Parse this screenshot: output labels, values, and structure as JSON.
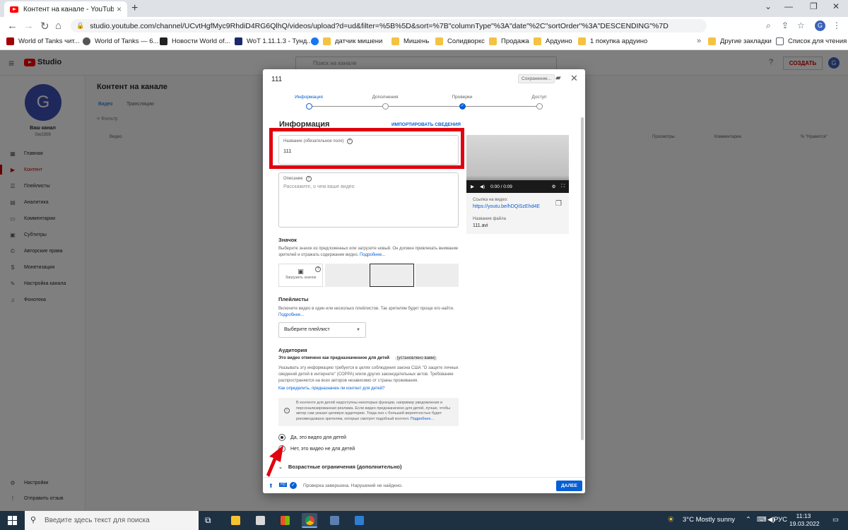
{
  "browser": {
    "tab_title": "Контент на канале - YouTube Studio",
    "url": "studio.youtube.com/channel/UCvtHgfMyc9RhdiD4RG6QlhQ/videos/upload?d=ud&filter=%5B%5D&sort=%7B\"columnType\"%3A\"date\"%2C\"sortOrder\"%3A\"DESCENDING\"%7D",
    "profile_initial": "G",
    "bookmarks": [
      "World of Tanks чит...",
      "World of Tanks — 6...",
      "Новости World of...",
      "WoT 1.11.1.3 - Тунд...",
      "датчик мишени",
      "Мишень",
      "Солидворкс",
      "Продажа",
      "Ардуино",
      "1 покупка ардуино"
    ],
    "other_bookmarks": "Другие закладки",
    "reading_list": "Список для чтения"
  },
  "studio": {
    "search_placeholder": "Поиск на канале",
    "create_label": "СОЗДАТЬ",
    "avatar_initial": "G",
    "channel_name": "Ваш канал",
    "channel_handle": "Gw2309",
    "sidebar": [
      {
        "label": "Главная",
        "icon": "dashboard-icon"
      },
      {
        "label": "Контент",
        "icon": "content-icon",
        "active": true
      },
      {
        "label": "Плейлисты",
        "icon": "playlists-icon"
      },
      {
        "label": "Аналитика",
        "icon": "analytics-icon"
      },
      {
        "label": "Комментарии",
        "icon": "comments-icon"
      },
      {
        "label": "Субтитры",
        "icon": "subtitles-icon"
      },
      {
        "label": "Авторские права",
        "icon": "copyright-icon"
      },
      {
        "label": "Монетизация",
        "icon": "monetization-icon"
      },
      {
        "label": "Настройка канала",
        "icon": "customization-icon"
      },
      {
        "label": "Фонотека",
        "icon": "audio-library-icon"
      }
    ],
    "sidebar_bottom": [
      "Настройки",
      "Отправить отзыв"
    ],
    "page_title": "Контент на канале",
    "tabs": [
      "Видео",
      "Трансляции"
    ],
    "filter_label": "Фильтр",
    "columns": [
      "Видео",
      "Просмотры",
      "Комментарии",
      "% \"Нравится\""
    ]
  },
  "modal": {
    "title": "111",
    "saving_label": "Сохранение...",
    "steps": [
      "Информация",
      "Дополнения",
      "Проверки",
      "Доступ"
    ],
    "section_title": "Информация",
    "import_link": "ИМПОРТИРОВАТЬ СВЕДЕНИЯ",
    "title_field_label": "Название (обязательное поле)",
    "title_field_value": "111",
    "desc_field_label": "Описание",
    "desc_placeholder": "Расскажите, о чем ваше видео",
    "video_time": "0:00 / 0:09",
    "link_label": "Ссылка на видео:",
    "link_value": "https://youtu.be/hDQiSzEhd4E",
    "filename_label": "Название файла",
    "filename_value": "111.avi",
    "thumb_title": "Значок",
    "thumb_desc": "Выберите значок из предложенных или загрузите новый. Он должен привлекать внимание зрителей и отражать содержание видео.",
    "more_link": "Подробнее...",
    "thumb_upload_label": "Загрузить значок",
    "playlists_title": "Плейлисты",
    "playlists_desc": "Включите видео в один или несколько плейлистов. Так зрителям будет проще его найти.",
    "more_link2": "Подробнее...",
    "playlist_select": "Выберите плейлист",
    "audience_title": "Аудитория",
    "audience_subtitle": "Это видео отмечено как предназначенное для детей",
    "audience_badge": "(установлено вами)",
    "audience_desc": "Указывать эту информацию требуется в целях соблюдения закона США \"О защите личных сведений детей в интернете\" (COPPA) и/или других законодательных актов. Требование распространяется на всех авторов независимо от страны проживания.",
    "audience_link": "Как определить, предназначен ли контент для детей?",
    "info_text": "В контенте для детей недоступны некоторые функции, например уведомления и персонализированная реклама. Если видео предназначено для детей, лучше, чтобы автор сам указал целевую аудиторию. Тогда оно с большей вероятностью будет рекомендовано зрителям, которые смотрят подобный контент.",
    "info_link": "Подробнее...",
    "radio_yes": "Да, это видео для детей",
    "radio_no": "Нет, это видео не для детей",
    "age_restriction": "Возрастные ограничения (дополнительно)",
    "footer_status": "Проверка завершена. Нарушений не найдено.",
    "next_button": "ДАЛЕЕ"
  },
  "taskbar": {
    "search_placeholder": "Введите здесь текст для поиска",
    "weather": "3°C  Mostly sunny",
    "language": "РУС",
    "time": "11:13",
    "date": "19.03.2022"
  },
  "colors": {
    "accent": "#065fd4",
    "highlight_red": "#e0000f",
    "youtube_red": "#ff0000"
  }
}
